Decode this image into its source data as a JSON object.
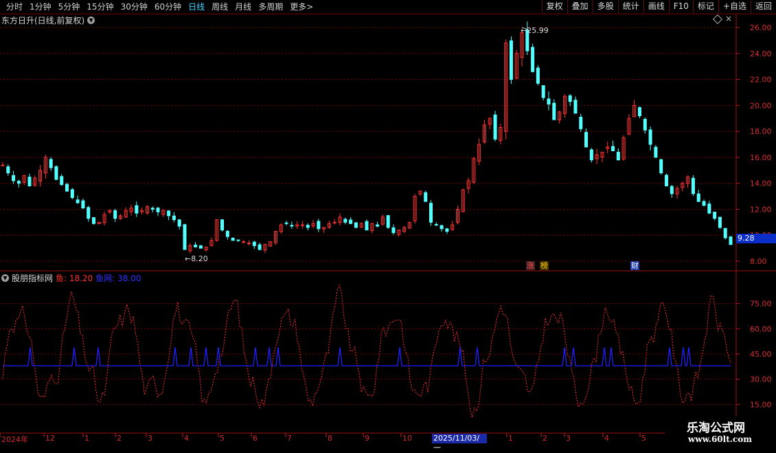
{
  "toolbar": {
    "periods": [
      "分时",
      "1分钟",
      "5分钟",
      "15分钟",
      "30分钟",
      "60分钟",
      "日线",
      "周线",
      "月线",
      "多周期",
      "更多>"
    ],
    "active_period": "日线",
    "right_buttons": [
      "复权",
      "叠加",
      "多股",
      "统计",
      "画线",
      "F10",
      "标记",
      "+自选",
      "返回"
    ]
  },
  "main_chart": {
    "title": "东方日升(日线,前复权)",
    "high_label": "25.99",
    "low_label": "8.20",
    "last_price": "9.28",
    "markers": [
      {
        "text": "涨",
        "color": "#ff5050",
        "bg": "#402020"
      },
      {
        "text": "榜",
        "color": "#ffd000",
        "bg": "#403000"
      },
      {
        "text": "财",
        "color": "#ffffff",
        "bg": "#1b3aa8"
      }
    ],
    "y_ticks": [
      "26.00",
      "24.00",
      "22.00",
      "20.00",
      "18.00",
      "16.00",
      "14.00",
      "12.00",
      "10.00",
      "8.00"
    ]
  },
  "indicator": {
    "name": "股朋指标网",
    "line1_label": "鱼",
    "line1_value": "18.20",
    "line2_label": "鱼网",
    "line2_value": "38.00",
    "y_ticks": [
      "75.00",
      "60.00",
      "45.00",
      "30.00",
      "15.00"
    ]
  },
  "x_axis": {
    "labels": [
      "2024年",
      "12",
      "1",
      "2",
      "3",
      "4",
      "5",
      "6",
      "7",
      "8",
      "9",
      "10",
      "1",
      "2",
      "3",
      "4",
      "5"
    ],
    "cursor_date": "2025/11/03/一"
  },
  "watermark": {
    "line1": "乐淘公式网",
    "line2": "www.60lt.com"
  },
  "colors": {
    "up": "#ff3333",
    "down": "#54ffff",
    "grid": "#7a0000",
    "axis_text": "#d83030",
    "fish": "#ff3030",
    "net": "#2020ff"
  },
  "chart_data": {
    "type": "candlestick",
    "close_series_approx": [
      15.4,
      14.8,
      14.2,
      14.0,
      14.6,
      13.8,
      14.4,
      15.0,
      16.0,
      15.2,
      14.3,
      13.9,
      13.4,
      12.9,
      12.5,
      12.1,
      11.3,
      10.9,
      11.0,
      11.6,
      11.9,
      11.3,
      11.5,
      11.9,
      12.1,
      11.7,
      11.9,
      12.2,
      12.0,
      11.8,
      11.9,
      11.5,
      11.2,
      10.7,
      8.9,
      9.2,
      9.1,
      9.0,
      9.1,
      9.6,
      11.2,
      10.4,
      9.9,
      9.6,
      9.6,
      9.5,
      9.4,
      9.2,
      8.9,
      9.3,
      9.5,
      10.3,
      10.8,
      10.9,
      10.7,
      10.8,
      10.8,
      10.6,
      10.9,
      10.5,
      10.6,
      10.9,
      11.0,
      11.4,
      11.0,
      10.9,
      10.6,
      10.9,
      10.4,
      10.9,
      10.7,
      11.4,
      10.6,
      10.2,
      10.4,
      10.6,
      11.0,
      13.0,
      13.4,
      12.6,
      11.0,
      10.8,
      10.5,
      10.3,
      10.8,
      12.0,
      13.5,
      14.2,
      15.9,
      17.0,
      18.5,
      19.0,
      17.4,
      18.3,
      24.8,
      22.0,
      24.0,
      25.6,
      24.2,
      22.6,
      21.7,
      20.6,
      20.1,
      18.9,
      19.5,
      20.7,
      20.3,
      19.4,
      18.2,
      16.8,
      15.8,
      16.2,
      16.4,
      16.8,
      16.5,
      15.8,
      17.5,
      19.0,
      20.0,
      19.2,
      18.1,
      17.0,
      16.0,
      14.8,
      13.8,
      13.2,
      13.6,
      14.0,
      14.5,
      13.2,
      12.6,
      12.3,
      11.7,
      11.3,
      10.6,
      9.8,
      9.28
    ],
    "y_range": [
      7.5,
      26.5
    ],
    "indicator_y_range": [
      0,
      90
    ],
    "net_baseline": 38.0
  }
}
